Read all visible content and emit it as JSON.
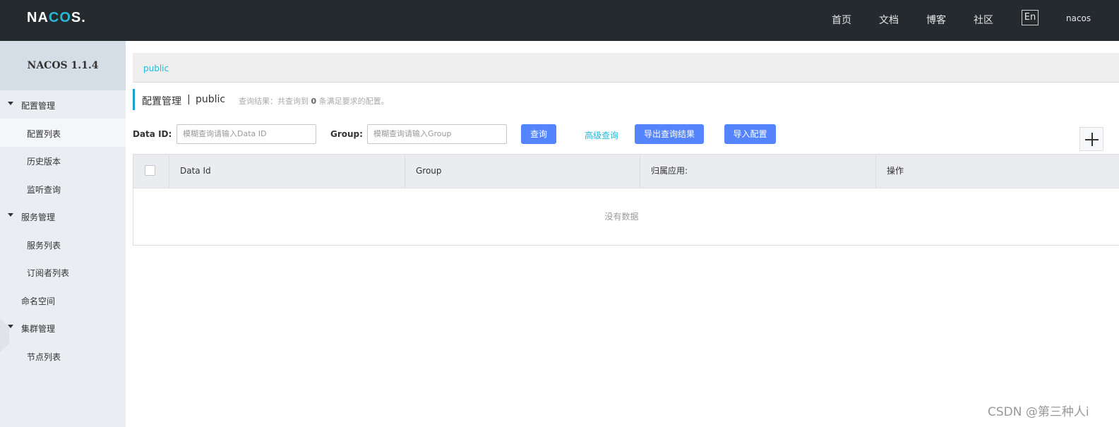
{
  "header": {
    "logo_part1": "NA",
    "logo_part2": "CO",
    "logo_part3": "S.",
    "nav": [
      "首页",
      "文档",
      "博客",
      "社区"
    ],
    "lang": "En",
    "user": "nacos"
  },
  "sidebar": {
    "version": "NACOS 1.1.4",
    "groups": [
      {
        "label": "配置管理",
        "items": [
          "配置列表",
          "历史版本",
          "监听查询"
        ]
      },
      {
        "label": "服务管理",
        "items": [
          "服务列表",
          "订阅者列表"
        ]
      },
      {
        "label": "命名空间"
      },
      {
        "label": "集群管理",
        "items": [
          "节点列表"
        ]
      }
    ],
    "active_item": "配置列表"
  },
  "namespace_bar": {
    "link": "public"
  },
  "title": {
    "main": "配置管理",
    "sep": "|",
    "namespace": "public",
    "result_prefix": "查询结果：共查询到",
    "result_count": "0",
    "result_suffix": "条满足要求的配置。"
  },
  "filters": {
    "data_id_label": "Data ID:",
    "data_id_placeholder": "模糊查询请输入Data ID",
    "group_label": "Group:",
    "group_placeholder": "模糊查询请输入Group",
    "query_button": "查询",
    "advanced_link": "高级查询",
    "export_button": "导出查询结果",
    "import_button": "导入配置"
  },
  "table": {
    "columns": [
      "Data Id",
      "Group",
      "归属应用:",
      "操作"
    ],
    "empty_text": "没有数据"
  },
  "watermark": "CSDN @第三种人i",
  "colors": {
    "topbar": "#252a2f",
    "primary_button": "#5584ff",
    "link": "#24b7d9",
    "sidebar": "#eaedf1"
  }
}
